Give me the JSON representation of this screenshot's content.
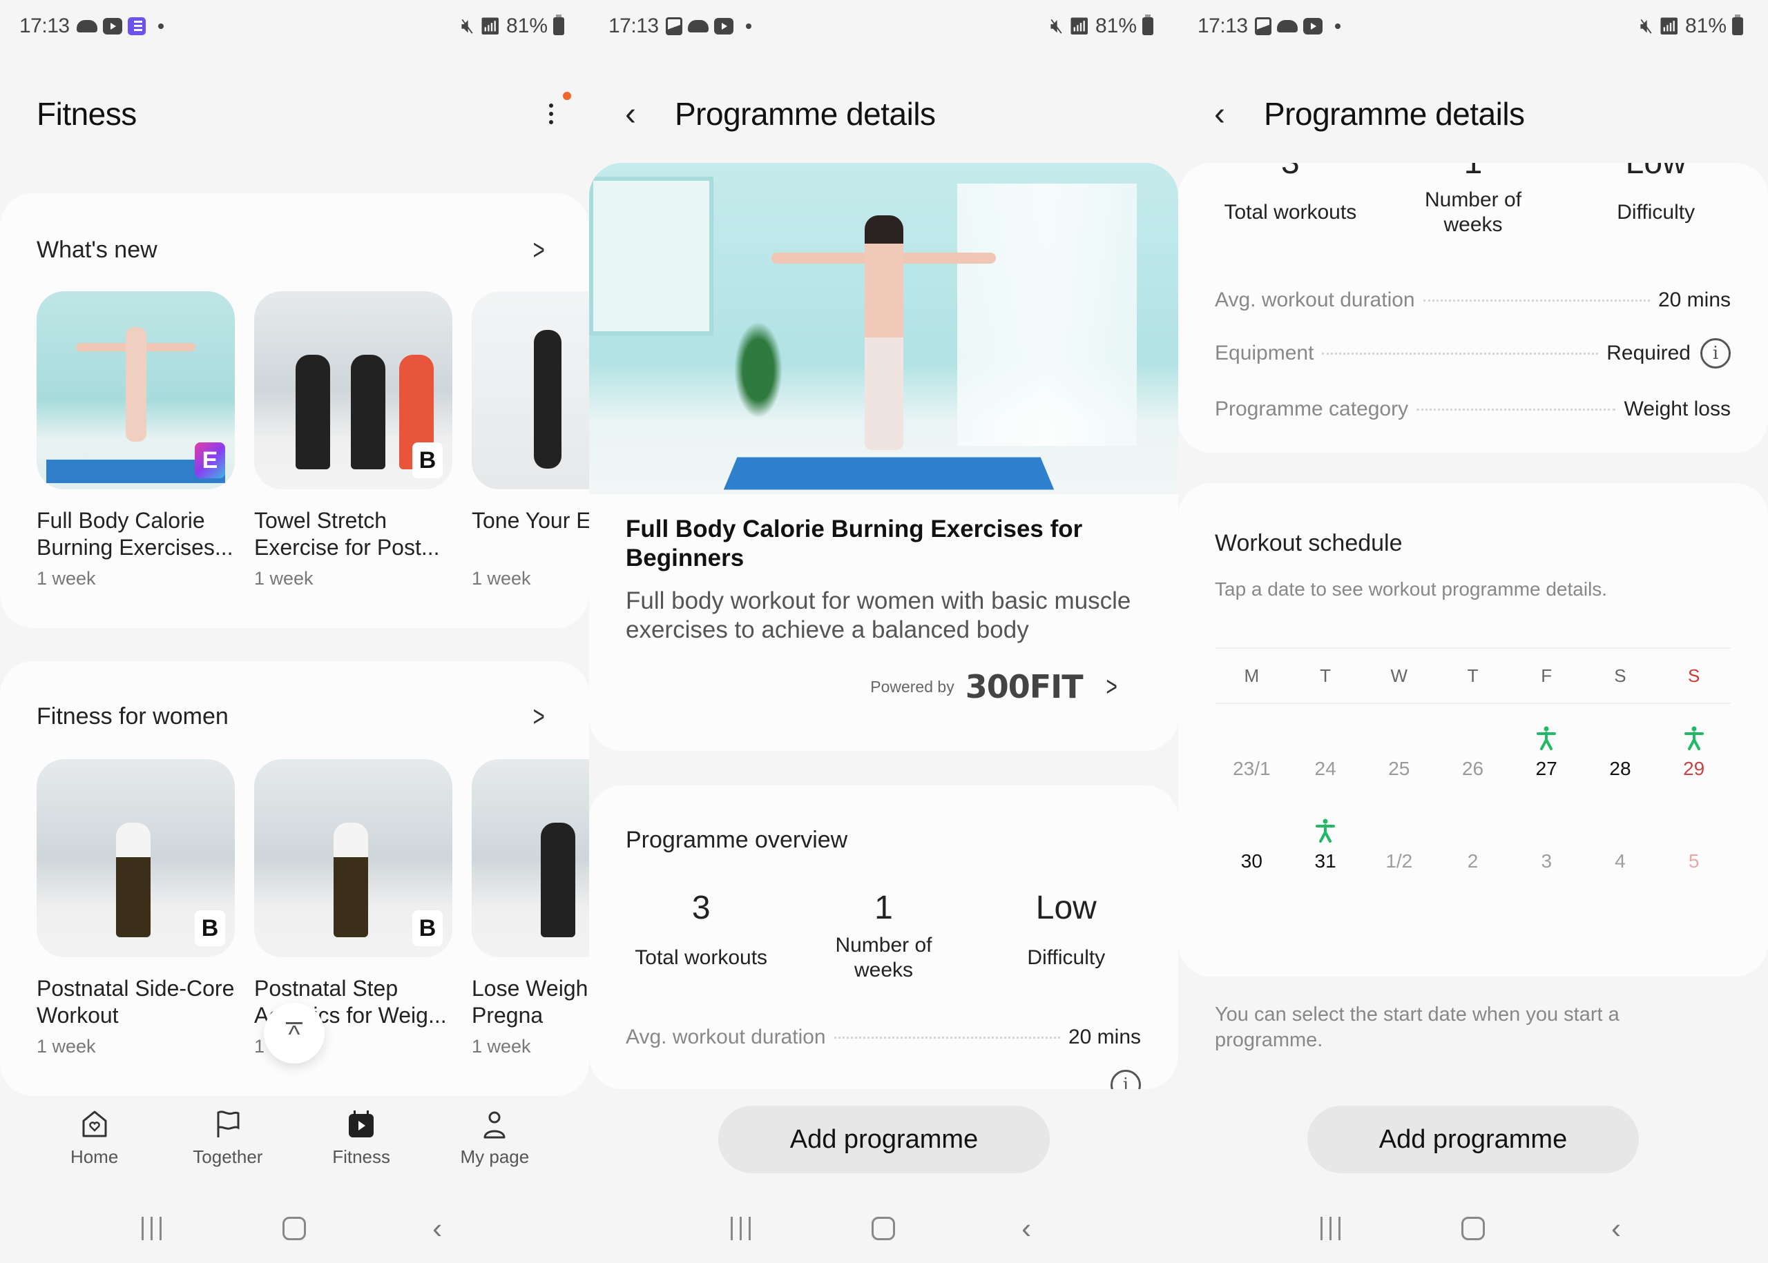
{
  "status_bar": {
    "time": "17:13",
    "battery": "81%",
    "panel1_notifications": [
      "cloud-icon",
      "youtube-icon",
      "list-app-icon",
      "dot"
    ],
    "panel23_notifications": [
      "gallery-icon",
      "cloud-icon",
      "youtube-icon",
      "dot"
    ],
    "right_icons": [
      "mute-icon",
      "wifi-6-icon",
      "signal-icon",
      "battery-icon"
    ]
  },
  "fitness_screen": {
    "title": "Fitness",
    "more_badge_color": "#f0672a",
    "sections": [
      {
        "title": "What's new",
        "items": [
          {
            "name": "Full Body Calorie Burning Exercises...",
            "duration": "1 week",
            "brand": "E"
          },
          {
            "name": "Towel Stretch Exercise for Post...",
            "duration": "1 week",
            "brand": "B"
          },
          {
            "name": "Tone Your E",
            "duration": "1 week",
            "brand": ""
          }
        ]
      },
      {
        "title": "Fitness for women",
        "items": [
          {
            "name": "Postnatal Side-Core Workout",
            "duration": "1 week",
            "brand": "B"
          },
          {
            "name": "Postnatal Step Aerobics for Weig...",
            "duration": "1 week",
            "brand": "B"
          },
          {
            "name": "Lose Weigh after Pregna",
            "duration": "1 week",
            "brand": ""
          }
        ]
      }
    ],
    "bottom_nav": [
      {
        "label": "Home",
        "icon": "home-heart-icon",
        "active": false
      },
      {
        "label": "Together",
        "icon": "flag-icon",
        "active": false
      },
      {
        "label": "Fitness",
        "icon": "fitness-calendar-icon",
        "active": true
      },
      {
        "label": "My page",
        "icon": "person-icon",
        "active": false
      }
    ]
  },
  "details": {
    "title": "Programme details",
    "programme_title": "Full Body Calorie Burning Exercises for Beginners",
    "programme_description": "Full body workout for women with basic muscle exercises to achieve a balanced body",
    "powered_by_label": "Powered by",
    "powered_by_brand": "300FIT",
    "overview_title": "Programme overview",
    "stats": [
      {
        "value": "3",
        "label": "Total workouts"
      },
      {
        "value": "1",
        "label": "Number of weeks"
      },
      {
        "value": "Low",
        "label": "Difficulty"
      }
    ],
    "rows": [
      {
        "key": "Avg. workout duration",
        "value": "20 mins"
      },
      {
        "key": "Equipment",
        "value": "Required",
        "info": true
      },
      {
        "key": "Programme category",
        "value": "Weight loss"
      }
    ],
    "add_button": "Add programme"
  },
  "schedule": {
    "title": "Workout schedule",
    "subtitle": "Tap a date to see workout programme details.",
    "weekdays": [
      "M",
      "T",
      "W",
      "T",
      "F",
      "S",
      "S"
    ],
    "weeks": [
      [
        {
          "label": "23/1",
          "state": "past",
          "workout": false
        },
        {
          "label": "24",
          "state": "past",
          "workout": false
        },
        {
          "label": "25",
          "state": "past",
          "workout": false
        },
        {
          "label": "26",
          "state": "past",
          "workout": false
        },
        {
          "label": "27",
          "state": "active",
          "workout": true
        },
        {
          "label": "28",
          "state": "active",
          "workout": false
        },
        {
          "label": "29",
          "state": "active-sun",
          "workout": true
        }
      ],
      [
        {
          "label": "30",
          "state": "active",
          "workout": false
        },
        {
          "label": "31",
          "state": "active",
          "workout": true
        },
        {
          "label": "1/2",
          "state": "future",
          "workout": false
        },
        {
          "label": "2",
          "state": "future",
          "workout": false
        },
        {
          "label": "3",
          "state": "future",
          "workout": false
        },
        {
          "label": "4",
          "state": "future",
          "workout": false
        },
        {
          "label": "5",
          "state": "future-sun",
          "workout": false
        }
      ]
    ],
    "workout_icon_color": "#22b865",
    "sunday_color": "#c93a3a",
    "start_note": "You can select the start date when you start a programme."
  }
}
